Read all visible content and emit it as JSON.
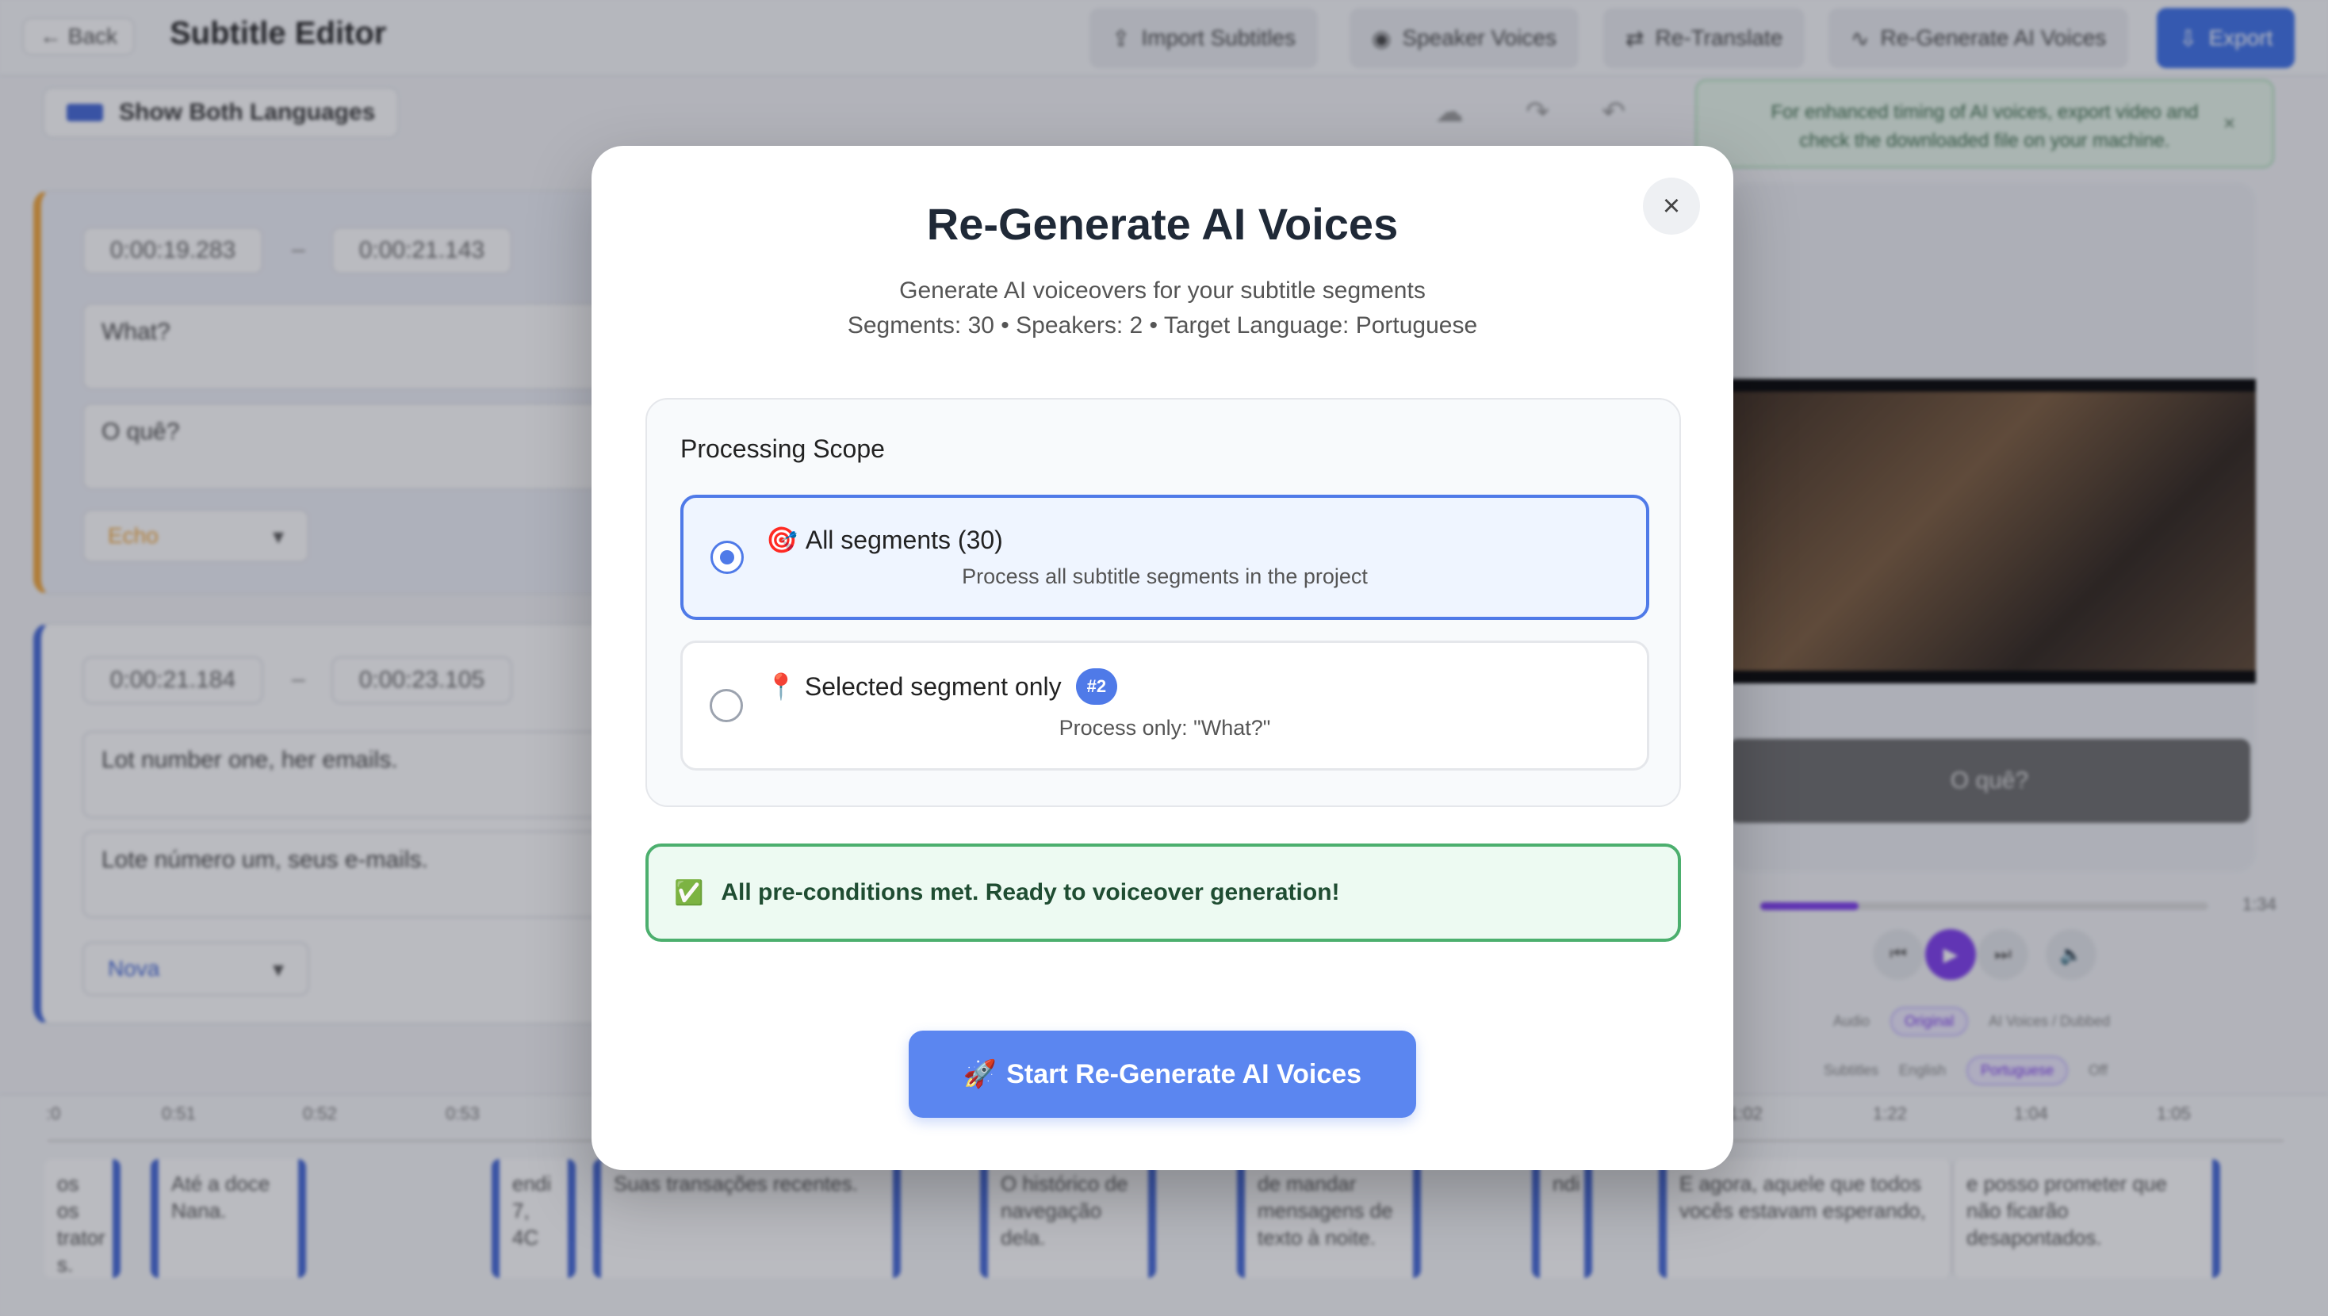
{
  "topbar": {
    "back_label": "← Back",
    "title": "Subtitle Editor",
    "buttons": [
      {
        "icon": "upload-icon",
        "label": "Import Subtitles"
      },
      {
        "icon": "microphone-icon",
        "label": "Speaker Voices"
      },
      {
        "icon": "translate-icon",
        "label": "Re-Translate"
      },
      {
        "icon": "waveform-icon",
        "label": "Re-Generate AI Voices"
      },
      {
        "icon": "download-icon",
        "label": "Export"
      }
    ]
  },
  "editor": {
    "language_toggle": "Show Both Languages",
    "segments": [
      {
        "start": "0:00:19.283",
        "end": "0:00:21.143",
        "source": "What?",
        "target": "O quê?",
        "voice": "Echo"
      },
      {
        "start": "0:00:21.184",
        "end": "0:00:23.105",
        "source": "Lot number one, her emails.",
        "target": "Lote número um, seus e-mails.",
        "voice": "Nova"
      }
    ]
  },
  "preview": {
    "notice": "For enhanced timing of AI voices, export video and check the downloaded file on your machine.",
    "caption": "O quê?",
    "duration": "1:34",
    "progress": 0.22,
    "audio_label": "Audio",
    "audio_options": [
      "Original",
      "AI Voices / Dubbed"
    ],
    "subtitles_label": "Subtitles",
    "subtitle_options": [
      "English",
      "Portuguese",
      "Off"
    ]
  },
  "timeline": {
    "ticks": [
      ":0",
      "0:51",
      "0:52",
      "0:53",
      "1:02",
      "1:22",
      "1:04",
      "1:05"
    ],
    "clips": [
      "os os trator s.",
      "Até a doce Nana.",
      "endi 7, 4C",
      "Suas transações recentes.",
      "O histórico de navegação dela.",
      "de mandar mensagens de texto à noite.",
      "ndi",
      "E agora, aquele que todos vocês estavam esperando,",
      "e posso prometer que não ficarão desapontados."
    ]
  },
  "modal": {
    "title": "Re-Generate AI Voices",
    "subtitle": "Generate AI voiceovers for your subtitle segments",
    "stats": "Segments: 30 • Speakers: 2 • Target Language: Portuguese",
    "scope_label": "Processing Scope",
    "options": [
      {
        "emoji": "🎯",
        "label": "All segments (30)",
        "desc": "Process all subtitle segments in the project",
        "selected": true
      },
      {
        "emoji": "📍",
        "label": "Selected segment only",
        "badge": "#2",
        "desc": "Process only: \"What?\"",
        "selected": false
      }
    ],
    "ready_icon": "✅",
    "ready_text": "All pre-conditions met. Ready to voiceover generation!",
    "start_emoji": "🚀",
    "start_label": "Start Re-Generate AI Voices",
    "close_glyph": "×"
  }
}
